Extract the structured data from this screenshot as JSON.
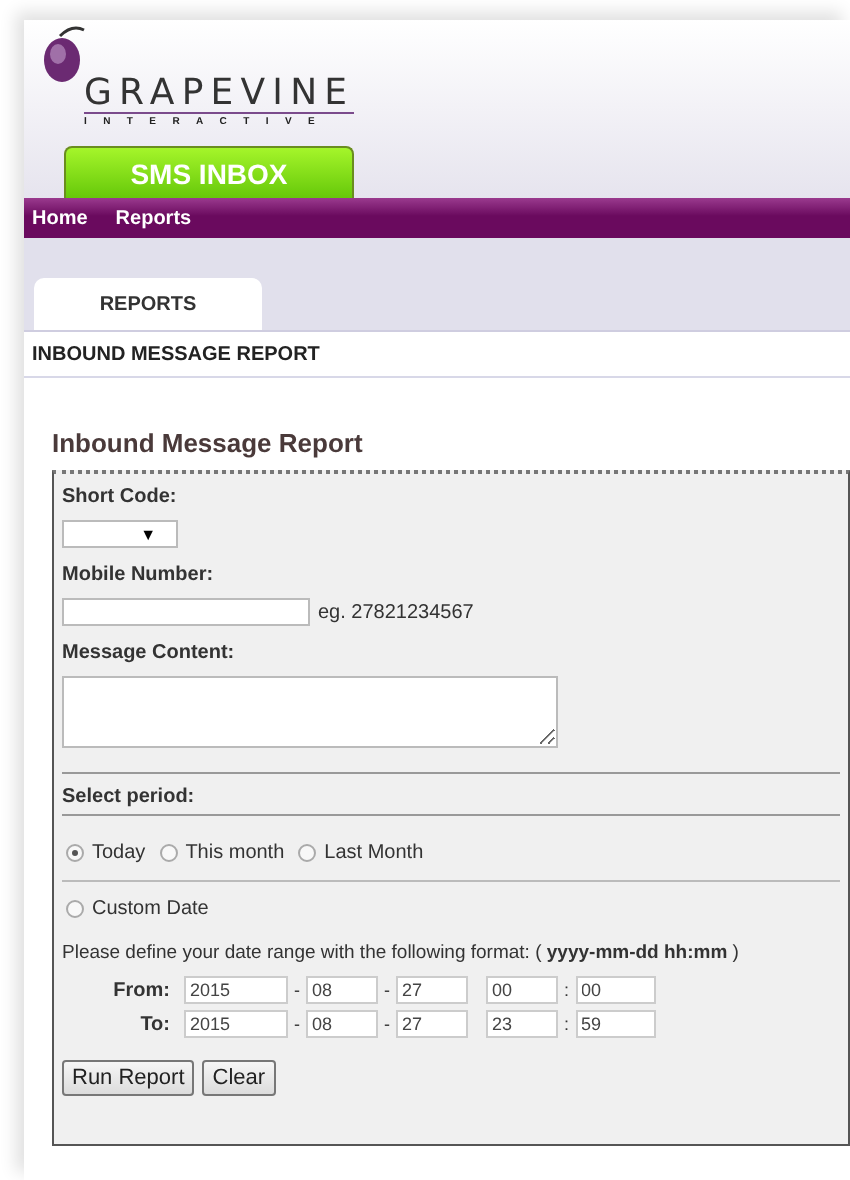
{
  "logo": {
    "name": "GRAPEVINE",
    "tagline": "INTERACTIVE"
  },
  "app_tab": {
    "label": "SMS INBOX"
  },
  "nav": [
    {
      "label": "Home"
    },
    {
      "label": "Reports"
    }
  ],
  "tabs": [
    {
      "label": "REPORTS",
      "selected": true
    }
  ],
  "breadcrumb": "INBOUND MESSAGE REPORT",
  "form": {
    "title": "Inbound Message Report",
    "short_code": {
      "label": "Short Code:",
      "caret": "▼"
    },
    "mobile": {
      "label": "Mobile Number:",
      "example": "eg. 27821234567"
    },
    "content": {
      "label": "Message Content:"
    },
    "period_label": "Select period:",
    "periods": [
      {
        "label": "Today",
        "selected": true
      },
      {
        "label": "This month",
        "selected": false
      },
      {
        "label": "Last Month",
        "selected": false
      }
    ],
    "custom_date": {
      "label": "Custom Date",
      "selected": false
    },
    "hint": "Please define your date range with the following format: ( **yyyy-mm-dd hh:mm** )",
    "ranges": [
      {
        "label": "From:",
        "year": "2015",
        "month": "08",
        "day": "27",
        "hour": "00",
        "minute": "00"
      },
      {
        "label": "To:",
        "year": "2015",
        "month": "08",
        "day": "27",
        "hour": "23",
        "minute": "59"
      }
    ],
    "date_sep": "-",
    "time_sep": ":",
    "buttons": [
      "Run Report",
      "Clear"
    ]
  }
}
